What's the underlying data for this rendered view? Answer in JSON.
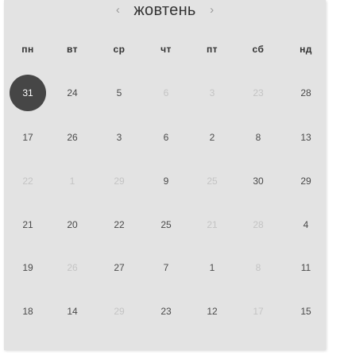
{
  "header": {
    "prev_icon": "‹",
    "month_label": "жовтень",
    "next_icon": "›"
  },
  "weekdays": [
    "пн",
    "вт",
    "ср",
    "чт",
    "пт",
    "сб",
    "нд"
  ],
  "weeks": [
    [
      {
        "label": "31",
        "state": "selected"
      },
      {
        "label": "24",
        "state": "normal"
      },
      {
        "label": "5",
        "state": "normal"
      },
      {
        "label": "6",
        "state": "muted"
      },
      {
        "label": "3",
        "state": "muted"
      },
      {
        "label": "23",
        "state": "muted"
      },
      {
        "label": "28",
        "state": "normal"
      }
    ],
    [
      {
        "label": "17",
        "state": "normal"
      },
      {
        "label": "26",
        "state": "normal"
      },
      {
        "label": "3",
        "state": "normal"
      },
      {
        "label": "6",
        "state": "normal"
      },
      {
        "label": "2",
        "state": "normal"
      },
      {
        "label": "8",
        "state": "normal"
      },
      {
        "label": "13",
        "state": "normal"
      }
    ],
    [
      {
        "label": "22",
        "state": "muted"
      },
      {
        "label": "1",
        "state": "muted"
      },
      {
        "label": "29",
        "state": "muted"
      },
      {
        "label": "9",
        "state": "normal"
      },
      {
        "label": "25",
        "state": "muted"
      },
      {
        "label": "30",
        "state": "normal"
      },
      {
        "label": "29",
        "state": "normal"
      }
    ],
    [
      {
        "label": "21",
        "state": "normal"
      },
      {
        "label": "20",
        "state": "normal"
      },
      {
        "label": "22",
        "state": "normal"
      },
      {
        "label": "25",
        "state": "normal"
      },
      {
        "label": "21",
        "state": "muted"
      },
      {
        "label": "28",
        "state": "muted"
      },
      {
        "label": "4",
        "state": "normal"
      }
    ],
    [
      {
        "label": "19",
        "state": "normal"
      },
      {
        "label": "26",
        "state": "muted"
      },
      {
        "label": "27",
        "state": "normal"
      },
      {
        "label": "7",
        "state": "normal"
      },
      {
        "label": "1",
        "state": "normal"
      },
      {
        "label": "8",
        "state": "muted"
      },
      {
        "label": "11",
        "state": "normal"
      }
    ],
    [
      {
        "label": "18",
        "state": "normal"
      },
      {
        "label": "14",
        "state": "normal"
      },
      {
        "label": "29",
        "state": "muted"
      },
      {
        "label": "23",
        "state": "normal"
      },
      {
        "label": "12",
        "state": "normal"
      },
      {
        "label": "17",
        "state": "muted"
      },
      {
        "label": "15",
        "state": "normal"
      }
    ]
  ],
  "colors": {
    "panel_background": "#e3e3e3",
    "selected_background": "#464646",
    "day_text": "#4a4a4a",
    "muted_text": "#c4c4c4"
  }
}
